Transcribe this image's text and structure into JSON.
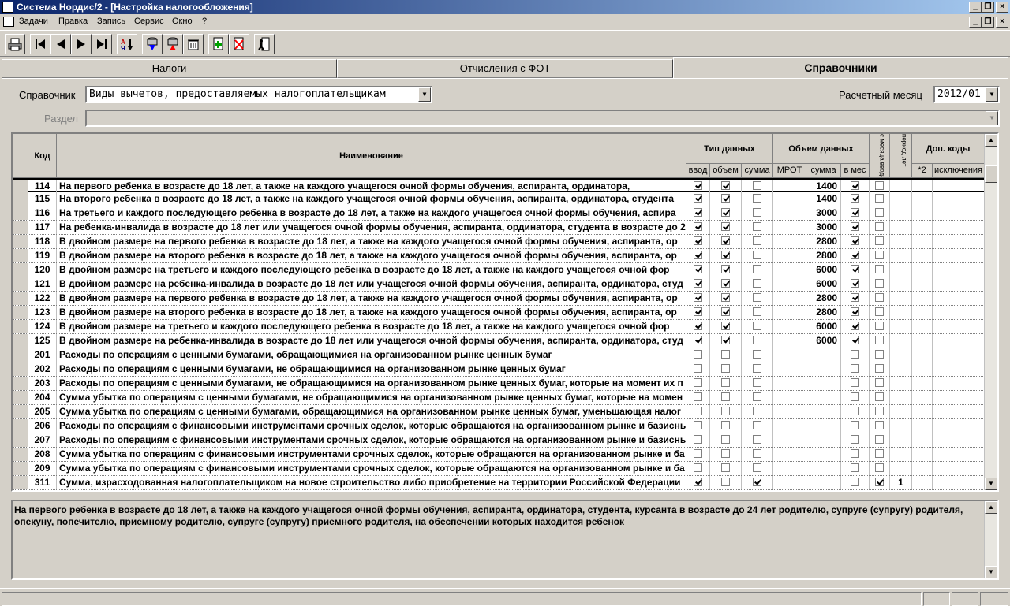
{
  "window": {
    "title": "Система Нордис/2 - [Настройка налогообложения]"
  },
  "menu": [
    "Задачи",
    "Правка",
    "Запись",
    "Сервис",
    "Окно",
    "?"
  ],
  "tabs": [
    {
      "label": "Налоги"
    },
    {
      "label": "Отчисления с ФОТ"
    },
    {
      "label": "Справочники"
    }
  ],
  "form": {
    "spravochnik_label": "Справочник",
    "spravochnik_value": "Виды вычетов, предоставляемых налогоплательщикам",
    "month_label": "Расчетный месяц",
    "month_value": "2012/01",
    "razdel_label": "Раздел",
    "razdel_value": ""
  },
  "table": {
    "headers": {
      "code": "Код",
      "name": "Наименование",
      "tip": "Тип данных",
      "vvod": "ввод",
      "obem": "объем",
      "summa": "сумма",
      "obem_dannyh": "Объем данных",
      "mrot": "МРОТ",
      "summa2": "сумма",
      "v_mes": "в мес",
      "s_mesyaca": "с месяца ввода",
      "period": "период лет",
      "dop": "Доп. коды",
      "x2": "*2",
      "iskl": "исключения"
    },
    "rows": [
      {
        "code": "114",
        "name": "На первого ребенка в возрасте до 18 лет, а также на каждого учащегося очной формы обучения, аспиранта, ординатора,",
        "vvod": true,
        "obem": true,
        "summa": false,
        "sum2": "1400",
        "vmes": true,
        "smes": false,
        "period": ""
      },
      {
        "code": "115",
        "name": "На второго ребенка в возрасте до 18 лет, а также на каждого учащегося очной формы обучения, аспиранта, ординатора, студента",
        "vvod": true,
        "obem": true,
        "summa": false,
        "sum2": "1400",
        "vmes": true,
        "smes": false,
        "period": ""
      },
      {
        "code": "116",
        "name": "На третьего и каждого последующего ребенка в возрасте до 18 лет, а также на каждого учащегося очной формы обучения, аспира",
        "vvod": true,
        "obem": true,
        "summa": false,
        "sum2": "3000",
        "vmes": true,
        "smes": false,
        "period": ""
      },
      {
        "code": "117",
        "name": "На ребенка-инвалида в возрасте до 18 лет или учащегося очной формы обучения, аспиранта, ординатора, студента в возрасте до 2",
        "vvod": true,
        "obem": true,
        "summa": false,
        "sum2": "3000",
        "vmes": true,
        "smes": false,
        "period": ""
      },
      {
        "code": "118",
        "name": "В двойном размере на первого ребенка в возрасте до 18 лет, а также на каждого учащегося очной формы обучения, аспиранта, ор",
        "vvod": true,
        "obem": true,
        "summa": false,
        "sum2": "2800",
        "vmes": true,
        "smes": false,
        "period": ""
      },
      {
        "code": "119",
        "name": "В двойном размере на второго ребенка в возрасте до 18 лет, а также на каждого учащегося очной формы обучения, аспиранта, ор",
        "vvod": true,
        "obem": true,
        "summa": false,
        "sum2": "2800",
        "vmes": true,
        "smes": false,
        "period": ""
      },
      {
        "code": "120",
        "name": "В двойном размере на третьего и каждого последующего ребенка в возрасте до 18 лет, а также на каждого учащегося очной фор",
        "vvod": true,
        "obem": true,
        "summa": false,
        "sum2": "6000",
        "vmes": true,
        "smes": false,
        "period": ""
      },
      {
        "code": "121",
        "name": "В двойном размере на ребенка-инвалида в возрасте до 18 лет или учащегося очной формы обучения, аспиранта, ординатора, студ",
        "vvod": true,
        "obem": true,
        "summa": false,
        "sum2": "6000",
        "vmes": true,
        "smes": false,
        "period": ""
      },
      {
        "code": "122",
        "name": "В двойном размере на первого ребенка в возрасте до 18 лет, а также на каждого учащегося очной формы обучения, аспиранта, ор",
        "vvod": true,
        "obem": true,
        "summa": false,
        "sum2": "2800",
        "vmes": true,
        "smes": false,
        "period": ""
      },
      {
        "code": "123",
        "name": "В двойном размере на второго ребенка в возрасте до 18 лет, а также на каждого учащегося очной формы обучения, аспиранта, ор",
        "vvod": true,
        "obem": true,
        "summa": false,
        "sum2": "2800",
        "vmes": true,
        "smes": false,
        "period": ""
      },
      {
        "code": "124",
        "name": "В двойном размере на третьего и каждого последующего ребенка в возрасте до 18 лет, а также на каждого учащегося очной фор",
        "vvod": true,
        "obem": true,
        "summa": false,
        "sum2": "6000",
        "vmes": true,
        "smes": false,
        "period": ""
      },
      {
        "code": "125",
        "name": "В двойном размере на ребенка-инвалида в возрасте до 18 лет или учащегося очной формы обучения, аспиранта, ординатора, студ",
        "vvod": true,
        "obem": true,
        "summa": false,
        "sum2": "6000",
        "vmes": true,
        "smes": false,
        "period": ""
      },
      {
        "code": "201",
        "name": "Расходы по операциям с ценными бумагами, обращающимися на организованном рынке ценных бумаг",
        "vvod": false,
        "obem": false,
        "summa": false,
        "sum2": "",
        "vmes": false,
        "smes": false,
        "period": ""
      },
      {
        "code": "202",
        "name": "Расходы по операциям с ценными бумагами, не обращающимися на организованном рынке ценных бумаг",
        "vvod": false,
        "obem": false,
        "summa": false,
        "sum2": "",
        "vmes": false,
        "smes": false,
        "period": ""
      },
      {
        "code": "203",
        "name": "Расходы по операциям с ценными бумагами, не обращающимися на организованном рынке ценных бумаг, которые на момент их п",
        "vvod": false,
        "obem": false,
        "summa": false,
        "sum2": "",
        "vmes": false,
        "smes": false,
        "period": ""
      },
      {
        "code": "204",
        "name": "Сумма убытка по операциям с ценными бумагами, не обращающимися на организованном рынке ценных бумаг, которые на момен",
        "vvod": false,
        "obem": false,
        "summa": false,
        "sum2": "",
        "vmes": false,
        "smes": false,
        "period": ""
      },
      {
        "code": "205",
        "name": "Сумма убытка по операциям с ценными бумагами, обращающимися на организованном рынке ценных бумаг, уменьшающая налог",
        "vvod": false,
        "obem": false,
        "summa": false,
        "sum2": "",
        "vmes": false,
        "smes": false,
        "period": ""
      },
      {
        "code": "206",
        "name": "Расходы по операциям с финансовыми инструментами срочных сделок, которые обращаются на организованном рынке и базисны",
        "vvod": false,
        "obem": false,
        "summa": false,
        "sum2": "",
        "vmes": false,
        "smes": false,
        "period": ""
      },
      {
        "code": "207",
        "name": "Расходы по операциям с финансовыми инструментами срочных сделок, которые обращаются на организованном рынке и базисны",
        "vvod": false,
        "obem": false,
        "summa": false,
        "sum2": "",
        "vmes": false,
        "smes": false,
        "period": ""
      },
      {
        "code": "208",
        "name": "Сумма убытка по операциям с финансовыми инструментами срочных сделок, которые обращаются на организованном рынке и ба",
        "vvod": false,
        "obem": false,
        "summa": false,
        "sum2": "",
        "vmes": false,
        "smes": false,
        "period": ""
      },
      {
        "code": "209",
        "name": "Сумма убытка по операциям с финансовыми инструментами срочных сделок, которые обращаются на организованном рынке и ба",
        "vvod": false,
        "obem": false,
        "summa": false,
        "sum2": "",
        "vmes": false,
        "smes": false,
        "period": ""
      },
      {
        "code": "311",
        "name": "Сумма, израсходованная налогоплательщиком на новое строительство либо приобретение на территории Российской Федерации",
        "vvod": true,
        "obem": false,
        "summa": true,
        "sum2": "",
        "vmes": false,
        "smes": true,
        "period": "1"
      }
    ]
  },
  "description": "На первого ребенка в возрасте до 18 лет, а также на каждого учащегося очной формы обучения, аспиранта, ординатора, студента, курсанта в возрасте до 24 лет родителю, супруге (супругу) родителя, опекуну, попечителю, приемному родителю, супруге (супругу) приемного родителя, на обеспечении которых находится ребенок"
}
